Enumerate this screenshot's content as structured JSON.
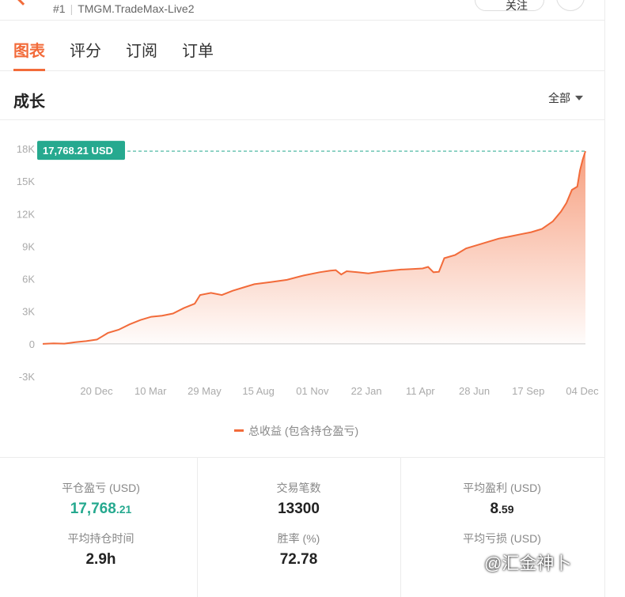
{
  "header": {
    "account_number": "#1",
    "account_name": "TMGM.TradeMax-Live2",
    "follow_label": "关注"
  },
  "tabs": [
    {
      "label": "图表",
      "active": true
    },
    {
      "label": "评分",
      "active": false
    },
    {
      "label": "订阅",
      "active": false
    },
    {
      "label": "订单",
      "active": false
    }
  ],
  "section": {
    "title": "成长",
    "range_value": "全部"
  },
  "chart_data": {
    "type": "area",
    "y_ticks": [
      "18K",
      "15K",
      "12K",
      "9K",
      "6K",
      "3K",
      "0",
      "-3K"
    ],
    "ylim": [
      -3000,
      18000
    ],
    "x_ticks": [
      "20 Dec",
      "10 Mar",
      "29 May",
      "15 Aug",
      "01 Nov",
      "22 Jan",
      "11 Apr",
      "28 Jun",
      "17 Sep",
      "04 Dec"
    ],
    "current_value_label": "17,768.21 USD",
    "current_value": 17768.21,
    "series": [
      {
        "name": "总收益 (包含持仓盈亏)",
        "color": "#f26b3a",
        "points": [
          [
            0.0,
            0
          ],
          [
            0.02,
            50
          ],
          [
            0.04,
            20
          ],
          [
            0.06,
            150
          ],
          [
            0.08,
            250
          ],
          [
            0.1,
            400
          ],
          [
            0.12,
            1000
          ],
          [
            0.14,
            1300
          ],
          [
            0.16,
            1800
          ],
          [
            0.18,
            2200
          ],
          [
            0.2,
            2500
          ],
          [
            0.22,
            2600
          ],
          [
            0.24,
            2800
          ],
          [
            0.26,
            3300
          ],
          [
            0.28,
            3700
          ],
          [
            0.29,
            4500
          ],
          [
            0.31,
            4700
          ],
          [
            0.33,
            4500
          ],
          [
            0.35,
            4900
          ],
          [
            0.37,
            5200
          ],
          [
            0.39,
            5500
          ],
          [
            0.42,
            5700
          ],
          [
            0.45,
            5900
          ],
          [
            0.48,
            6300
          ],
          [
            0.51,
            6600
          ],
          [
            0.53,
            6750
          ],
          [
            0.54,
            6800
          ],
          [
            0.55,
            6400
          ],
          [
            0.56,
            6700
          ],
          [
            0.58,
            6600
          ],
          [
            0.6,
            6500
          ],
          [
            0.62,
            6650
          ],
          [
            0.64,
            6750
          ],
          [
            0.66,
            6850
          ],
          [
            0.68,
            6900
          ],
          [
            0.7,
            6950
          ],
          [
            0.71,
            7100
          ],
          [
            0.72,
            6600
          ],
          [
            0.73,
            6650
          ],
          [
            0.74,
            7900
          ],
          [
            0.76,
            8200
          ],
          [
            0.78,
            8800
          ],
          [
            0.8,
            9100
          ],
          [
            0.82,
            9400
          ],
          [
            0.84,
            9700
          ],
          [
            0.86,
            9900
          ],
          [
            0.88,
            10100
          ],
          [
            0.9,
            10300
          ],
          [
            0.92,
            10600
          ],
          [
            0.94,
            11300
          ],
          [
            0.955,
            12200
          ],
          [
            0.965,
            13000
          ],
          [
            0.975,
            14200
          ],
          [
            0.985,
            14500
          ],
          [
            0.99,
            16000
          ],
          [
            0.995,
            17000
          ],
          [
            1.0,
            17768.21
          ]
        ]
      }
    ]
  },
  "stats": {
    "closed_pl": {
      "label": "平仓盈亏 (USD)",
      "int": "17,768",
      "dec": ".21"
    },
    "trades": {
      "label": "交易笔数",
      "value": "13300"
    },
    "avg_profit": {
      "label": "平均盈利 (USD)",
      "int": "8",
      "dec": ".59"
    },
    "avg_hold": {
      "label": "平均持仓时间",
      "value": "2.9h"
    },
    "win_rate": {
      "label": "胜率 (%)",
      "value": "72.78"
    },
    "avg_loss": {
      "label": "平均亏损 (USD)"
    }
  },
  "watermark": "@汇金神卜",
  "colors": {
    "accent": "#f26b3a",
    "positive": "#26a98f",
    "text": "#222222",
    "muted": "#888888"
  }
}
